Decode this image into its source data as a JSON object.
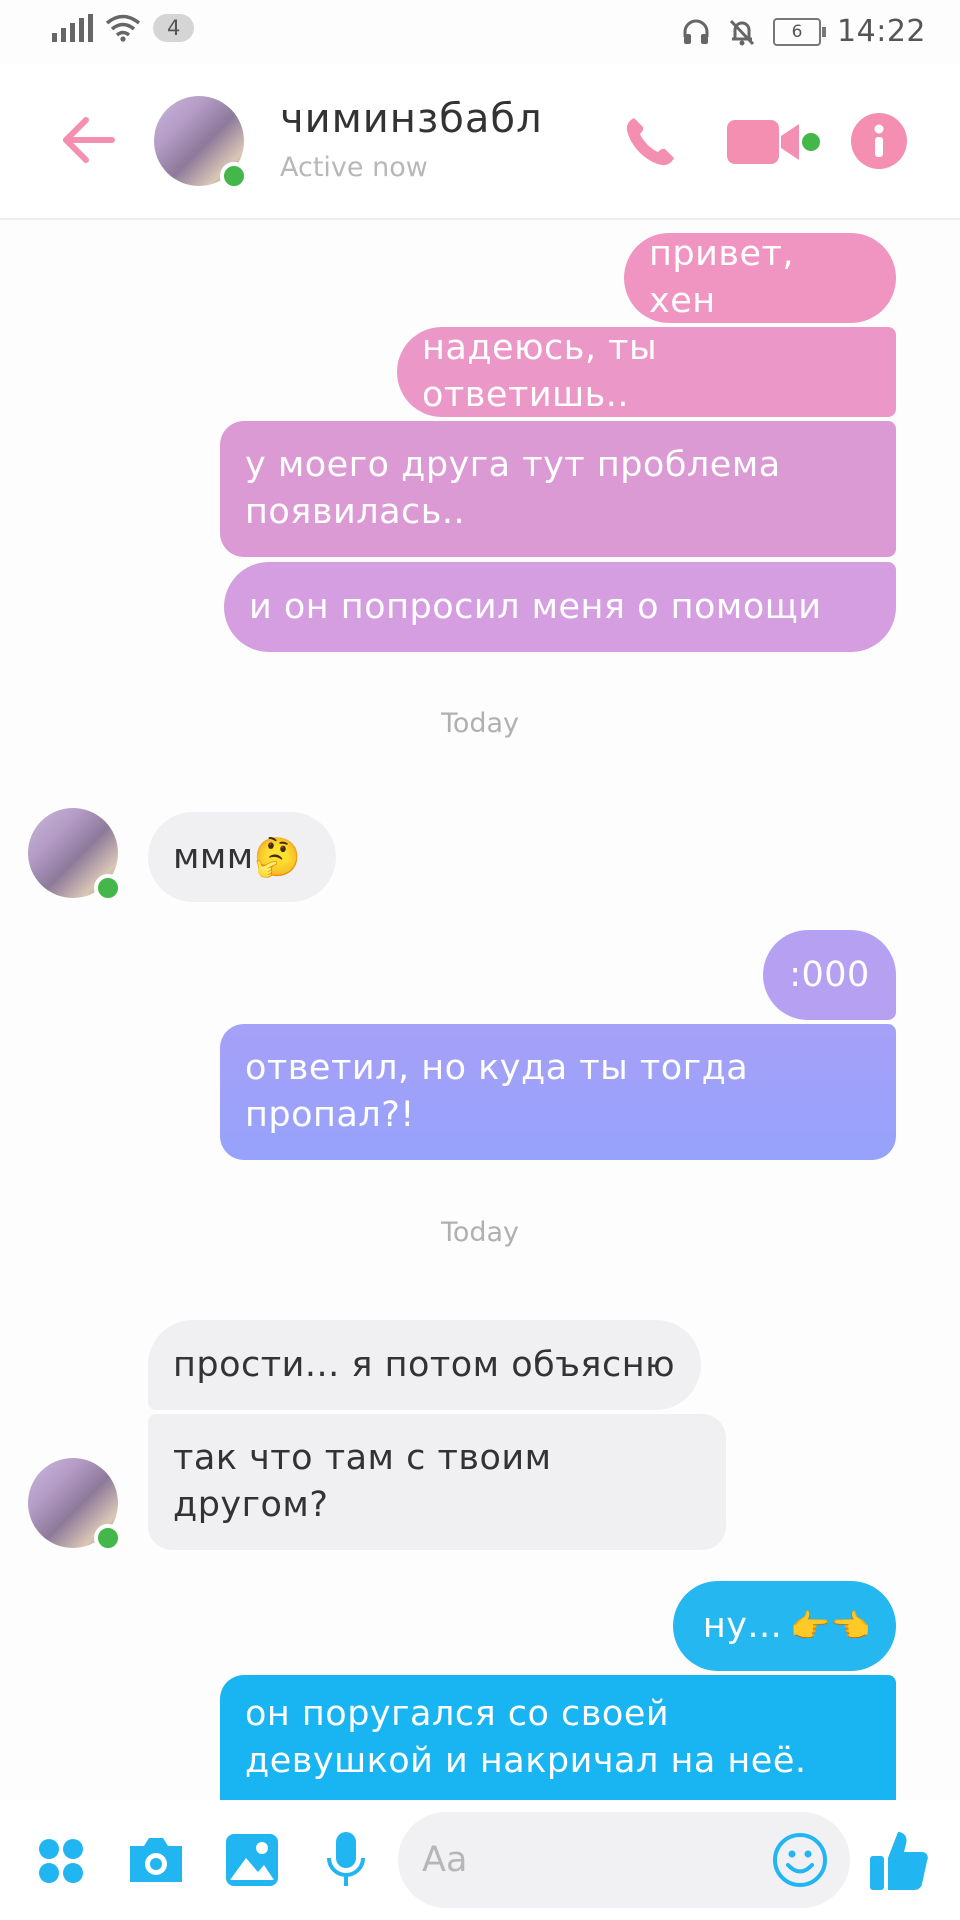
{
  "status_bar": {
    "sim_badge": "4",
    "battery": "6",
    "time": "14:22"
  },
  "header": {
    "contact_name": "чиминзбабл",
    "contact_status": "Active now",
    "icons": [
      "back-arrow-icon",
      "phone-icon",
      "video-camera-icon",
      "info-icon"
    ],
    "accent_color": "#f48fb1"
  },
  "messages": [
    {
      "text": "привет, хен",
      "dir": "out"
    },
    {
      "text": "надеюсь, ты ответишь..",
      "dir": "out"
    },
    {
      "text": "у моего друга тут проблема появилась..",
      "dir": "out"
    },
    {
      "text": "и он попросил меня о помощи",
      "dir": "out"
    },
    {
      "text": "ммм",
      "dir": "in",
      "emoji": "🤔"
    },
    {
      "text": ":000",
      "dir": "out"
    },
    {
      "text": "ответил, но куда ты тогда пропал?!",
      "dir": "out"
    },
    {
      "text": "прости... я потом объясню",
      "dir": "in"
    },
    {
      "text": "так что там с твоим другом?",
      "dir": "in"
    },
    {
      "text": "ну...",
      "dir": "out",
      "emoji": "👉👈"
    },
    {
      "text": "он поругался со своей девушкой и накричал на неё.",
      "dir": "out"
    }
  ],
  "timestamps": [
    "Today",
    "Today"
  ],
  "composer": {
    "placeholder": "Aa",
    "icons": [
      "menu-dots-icon",
      "camera-icon",
      "image-icon",
      "microphone-icon",
      "emoji-smile-icon",
      "like-thumb-icon"
    ],
    "accent_color": "#21b5f2"
  }
}
